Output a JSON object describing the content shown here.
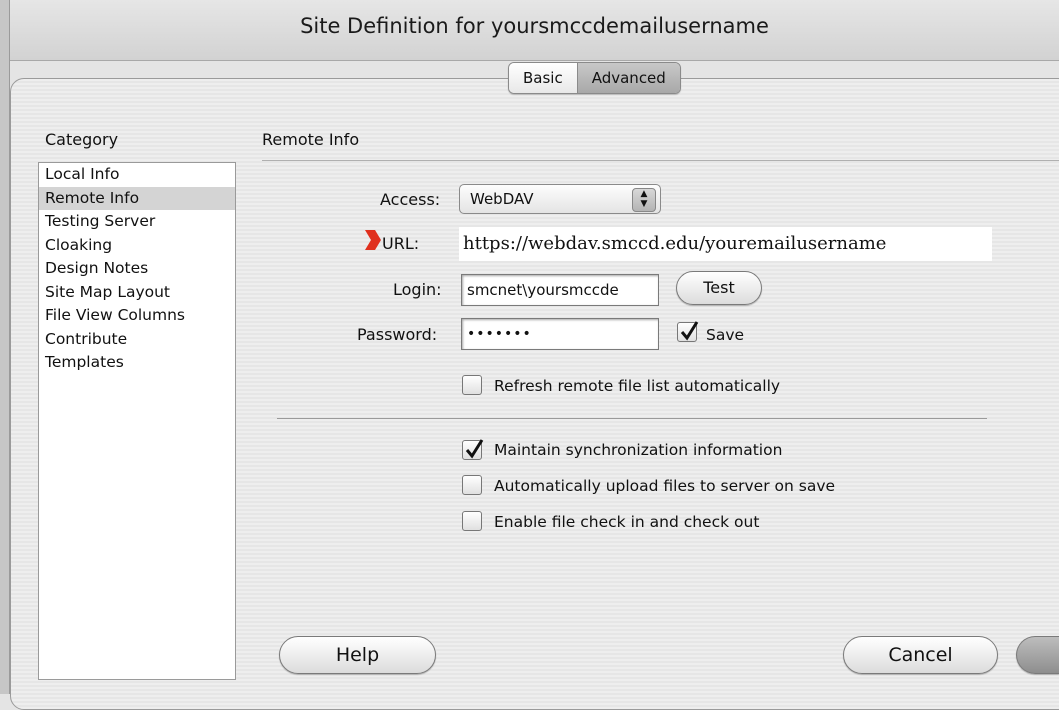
{
  "window": {
    "title": "Site Definition for yoursmccdemailusername"
  },
  "tabs": [
    {
      "label": "Basic"
    },
    {
      "label": "Advanced"
    }
  ],
  "sidebar": {
    "heading": "Category",
    "items": [
      {
        "label": "Local Info"
      },
      {
        "label": "Remote Info"
      },
      {
        "label": "Testing Server"
      },
      {
        "label": "Cloaking"
      },
      {
        "label": "Design Notes"
      },
      {
        "label": "Site Map Layout"
      },
      {
        "label": "File View Columns"
      },
      {
        "label": "Contribute"
      },
      {
        "label": "Templates"
      }
    ],
    "selected": "Remote Info"
  },
  "main": {
    "section_title": "Remote Info",
    "access": {
      "label": "Access:",
      "value": "WebDAV"
    },
    "url": {
      "label": "URL:",
      "value": "https://webdav.smccd.edu/youremailusername"
    },
    "login": {
      "label": "Login:",
      "value": "smcnet\\yoursmccde"
    },
    "test_label": "Test",
    "password": {
      "label": "Password:",
      "value": "•••••••"
    },
    "save": {
      "label": "Save",
      "checked": true
    },
    "refresh": {
      "label": "Refresh remote file list automatically",
      "checked": false
    },
    "maintain_sync": {
      "label": "Maintain synchronization information",
      "checked": true
    },
    "auto_upload": {
      "label": "Automatically upload files to server on save",
      "checked": false
    },
    "check_in_out": {
      "label": "Enable file check in and check out",
      "checked": false
    }
  },
  "footer": {
    "help_label": "Help",
    "cancel_label": "Cancel"
  },
  "colors": {
    "url_marker": "#e0301e"
  }
}
